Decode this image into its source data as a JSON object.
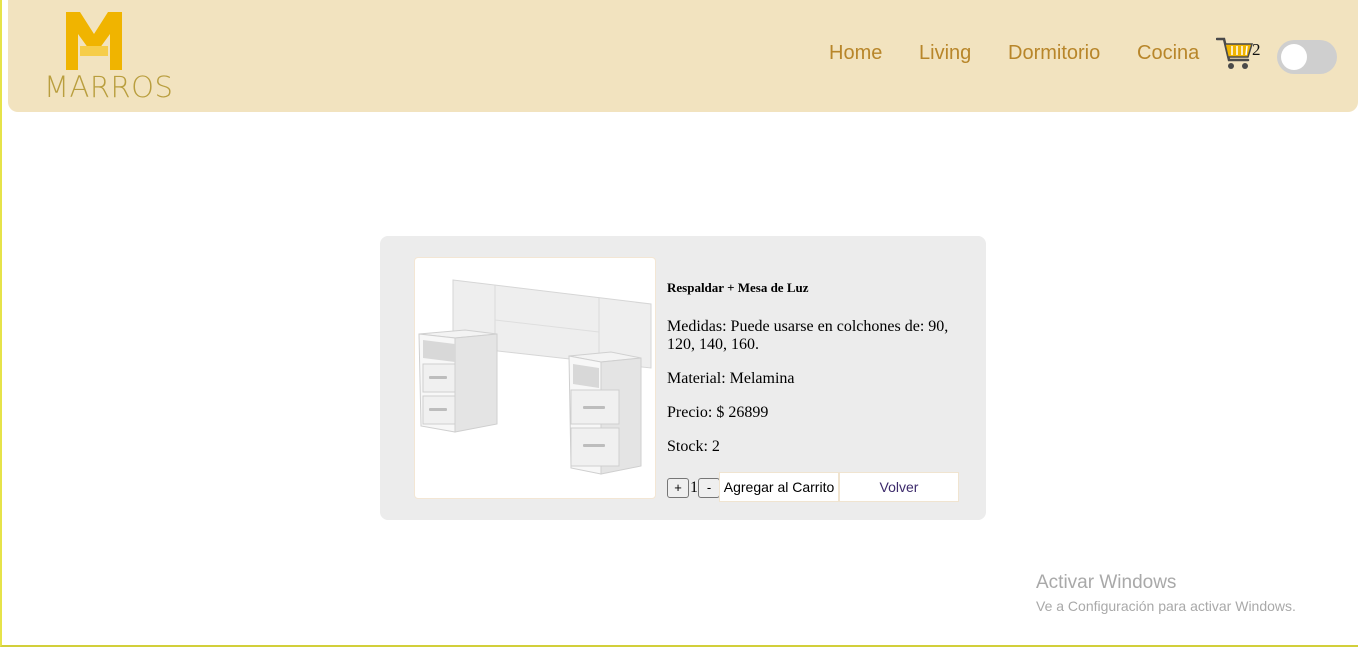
{
  "brand": {
    "name": "MARROS",
    "accent": "#f0b400"
  },
  "nav": {
    "links": [
      "Home",
      "Living",
      "Dormitorio",
      "Cocina"
    ],
    "cart_count": "2"
  },
  "product": {
    "title": "Respaldar + Mesa de Luz",
    "medidas": "Medidas: Puede usarse en colchones de: 90, 120, 140, 160.",
    "material": "Material: Melamina",
    "precio": "Precio: $ 26899",
    "stock": "Stock: 2",
    "quantity": "1",
    "plus_label": "+",
    "minus_label": "-",
    "add_label": "Agregar al Carrito",
    "back_label": "Volver"
  },
  "watermark": {
    "title": "Activar Windows",
    "subtitle": "Ve a Configuración para activar Windows."
  }
}
